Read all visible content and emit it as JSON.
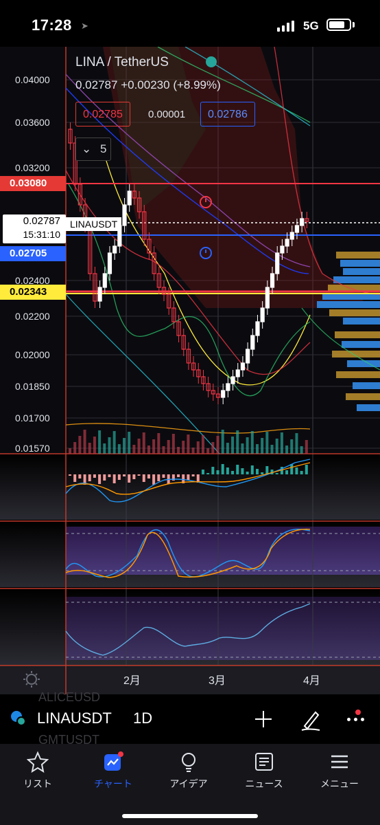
{
  "status_bar": {
    "time": "17:28",
    "network": "5G"
  },
  "chart": {
    "symbol_title": "LINA / TetherUS",
    "last_price": "0.02787",
    "change": "+0.00230",
    "change_pct": "(+8.99%)",
    "sell_price": "0.02785",
    "spread": "0.00001",
    "buy_price": "0.02786",
    "indicators_count": "5",
    "price_axis": [
      "0.04000",
      "0.03600",
      "0.03200",
      "0.02400",
      "0.02200",
      "0.02000",
      "0.01850",
      "0.01700",
      "0.01570"
    ],
    "tag_red": "0.03080",
    "tag_current": "0.02787",
    "tag_countdown": "15:31:10",
    "tag_symbol": "LINAUSDT",
    "tag_blue": "0.02705",
    "tag_yellow": "0.02343",
    "time_axis": [
      "2月",
      "3月",
      "4月"
    ],
    "colors": {
      "up": "#ffffff",
      "down": "#f23645",
      "blue_line": "#2962ff",
      "red_line": "#f23645",
      "yellow_line": "#ffeb3b"
    }
  },
  "symbol_bar": {
    "symbol": "LINAUSDT",
    "interval": "1D",
    "ghost_top": "ALICEUSD",
    "ghost_bottom": "GMTUSDT",
    "icons": [
      "plus-icon",
      "pen-icon",
      "more-icon"
    ]
  },
  "tab_bar": {
    "items": [
      {
        "label": "リスト",
        "icon": "star-icon"
      },
      {
        "label": "チャート",
        "icon": "chart-icon"
      },
      {
        "label": "アイデア",
        "icon": "bulb-icon"
      },
      {
        "label": "ニュース",
        "icon": "news-icon"
      },
      {
        "label": "メニュー",
        "icon": "menu-icon"
      }
    ],
    "active_color": "#2962ff"
  }
}
